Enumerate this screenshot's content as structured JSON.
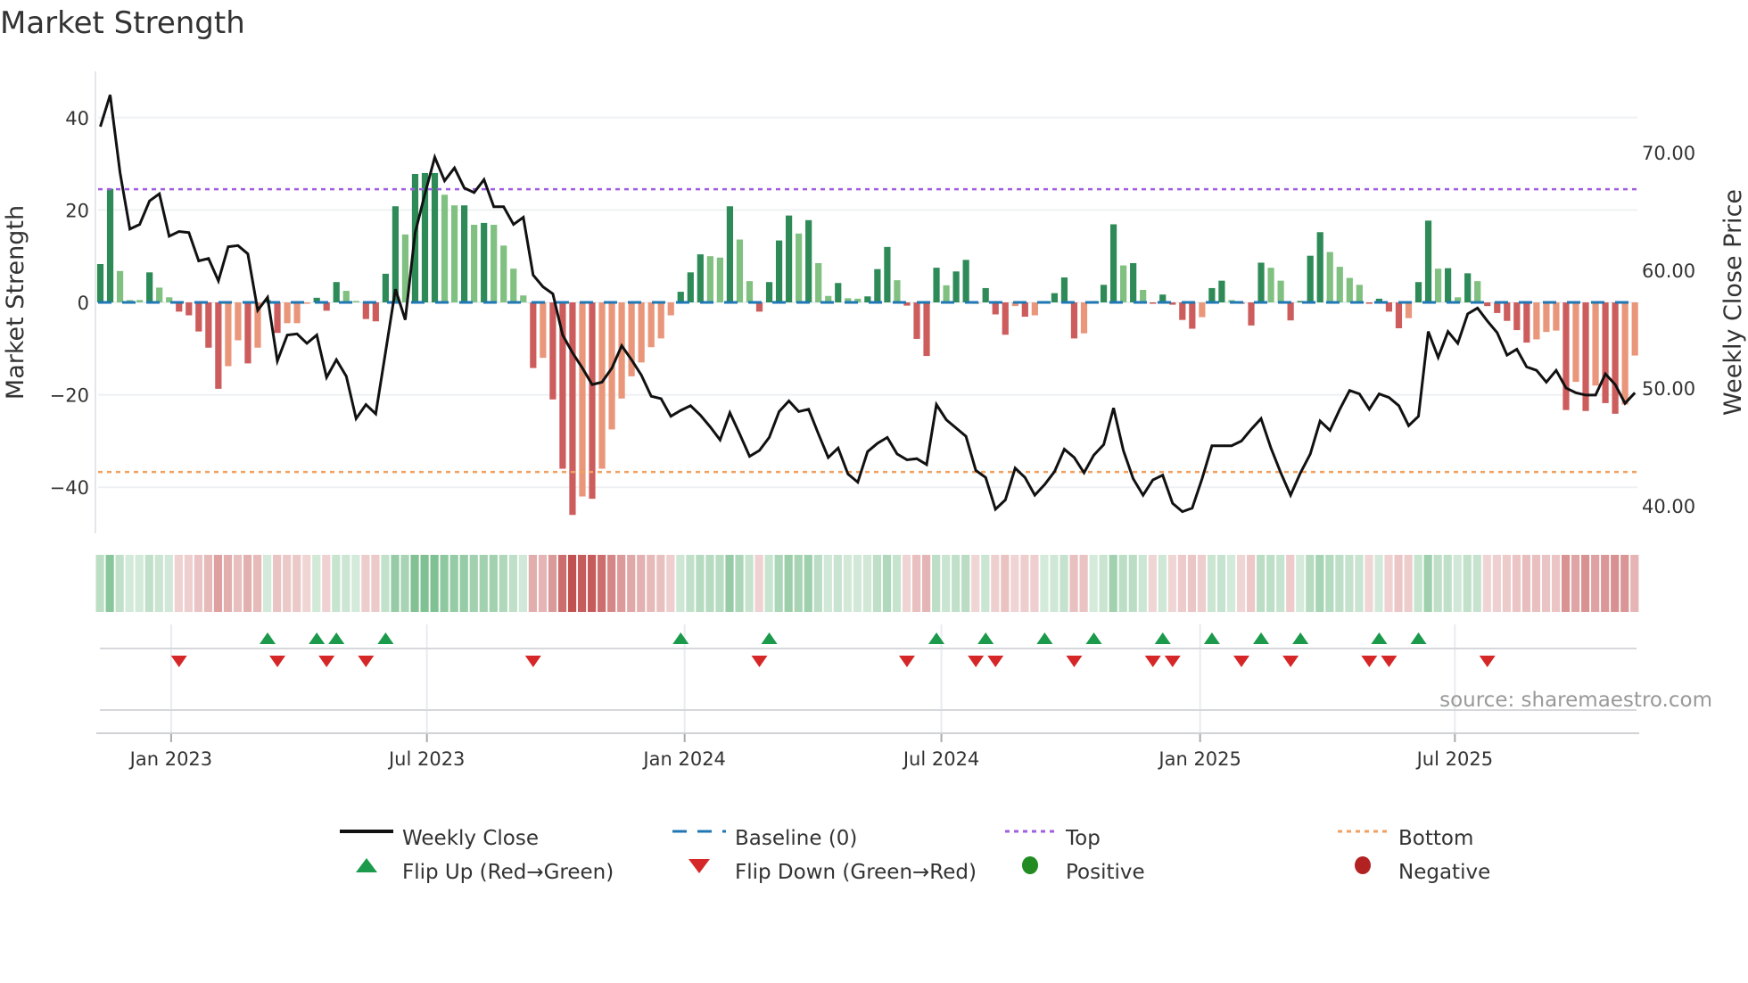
{
  "title": "Market Strength",
  "source": "source: sharemaestro.com",
  "colors": {
    "strong_green": "#2e8b57",
    "weak_green": "#80c080",
    "strong_red": "#cd5c5c",
    "weak_red": "#e9967a",
    "baseline": "#1f77b4",
    "top": "#a05ee0",
    "bottom": "#f0a060",
    "flip_up": "#1a9a4a",
    "flip_down": "#d62728",
    "positive": "#228b22",
    "negative": "#b22222",
    "close": "#111111"
  },
  "legend": [
    {
      "label": "Weekly Close",
      "icon": "solid-line"
    },
    {
      "label": "Baseline (0)",
      "icon": "dashed-line"
    },
    {
      "label": "Top",
      "icon": "dotted-line"
    },
    {
      "label": "Bottom",
      "icon": "dotted-line"
    },
    {
      "label": "Flip Up (Red→Green)",
      "icon": "triangle-up"
    },
    {
      "label": "Flip Down (Green→Red)",
      "icon": "triangle-down"
    },
    {
      "label": "Positive",
      "icon": "circle"
    },
    {
      "label": "Negative",
      "icon": "circle"
    }
  ],
  "chart_data": {
    "type": "bar+line",
    "title": "Market Strength",
    "ylabel": "Market Strength",
    "y2label": "Weekly Close Price",
    "ylim": [
      -50,
      50
    ],
    "y2lim": [
      37.65,
      76.9
    ],
    "yticks": [
      40,
      20,
      0,
      -20,
      -40
    ],
    "y2ticks": [
      "70.00",
      "60.00",
      "50.00",
      "40.00"
    ],
    "y2tick_values": [
      70,
      60,
      50,
      40
    ],
    "xticks": [
      {
        "label": "Jan 2023",
        "week": 7.2
      },
      {
        "label": "Jul 2023",
        "week": 33.2
      },
      {
        "label": "Jan 2024",
        "week": 59.4
      },
      {
        "label": "Jul 2024",
        "week": 85.5
      },
      {
        "label": "Jan 2025",
        "week": 111.8
      },
      {
        "label": "Jul 2025",
        "week": 137.7
      }
    ],
    "top_level": 24.5,
    "bottom_level": -36.7,
    "baseline": 0,
    "strength": [
      8.3,
      24.6,
      6.8,
      0.5,
      0.5,
      6.5,
      3.2,
      1.1,
      -2,
      -2.8,
      -6.3,
      -9.8,
      -18.7,
      -13.8,
      -8.2,
      -13.2,
      -9.8,
      0.5,
      -6.6,
      -4.5,
      -4.5,
      -0.3,
      1,
      -1.8,
      4.4,
      2.5,
      0.3,
      -3.6,
      -4.1,
      6.2,
      20.8,
      14.7,
      27.8,
      28,
      28,
      23.3,
      21,
      21,
      16.8,
      17.2,
      16.8,
      12.3,
      7.3,
      1.5,
      -14.2,
      -12,
      -21,
      -36,
      -46,
      -42,
      -42.5,
      -36,
      -27.5,
      -20.8,
      -16,
      -13,
      -9.7,
      -7.8,
      -2.8,
      2.3,
      6.5,
      10.4,
      10,
      9.7,
      20.8,
      13.6,
      4.6,
      -2,
      4.4,
      13.4,
      18.8,
      14.9,
      17.8,
      8.5,
      1.4,
      4.2,
      0.9,
      0.8,
      1.3,
      7.2,
      12,
      4.8,
      -0.7,
      -7.9,
      -11.6,
      7.5,
      3.7,
      6.7,
      9.2,
      -0.3,
      3.1,
      -2.6,
      -7,
      -0.8,
      -3.1,
      -2.8,
      0.3,
      2,
      5.4,
      -7.8,
      -6.7,
      0.3,
      3.8,
      16.9,
      8,
      8.5,
      2.7,
      -0.3,
      1.7,
      -0.5,
      -3.8,
      -5.7,
      -3.2,
      3.1,
      4.7,
      0.5,
      -0.3,
      -5,
      8.6,
      7.5,
      4.7,
      -3.9,
      0.3,
      10.1,
      15.2,
      10.9,
      7.7,
      5.3,
      3.8,
      -0.3,
      0.8,
      -2,
      -5.6,
      -3.4,
      4.4,
      17.7,
      7.3,
      7.4,
      1.1,
      6.3,
      4.6,
      -0.8,
      -2.3,
      -4,
      -6,
      -8.7,
      -8,
      -6.4,
      -6.1,
      -23.3,
      -17.2,
      -23.5,
      -18,
      -21.8,
      -24.1,
      -22.1,
      -11.5
    ],
    "shade": "GGgggGggRRRRRrrRrGRrrrGRGggRRGGgGGGggGgGggggRrRRRrRrrrrrrrrGGGggGggRGGGgGggGggGGGgRRRGgGGRGRRrRrGGGRrGGGgGgRGRRRrGGgRRGggRGGGggggRGRRrGGgGgGgRRRRRrrrRrRrRRrr",
    "weekly_close": [
      72.2,
      74.9,
      68.3,
      63.5,
      63.9,
      65.9,
      66.5,
      62.9,
      63.3,
      63.2,
      60.8,
      61,
      59.1,
      62,
      62.1,
      61.4,
      56.6,
      57.7,
      52.3,
      54.5,
      54.6,
      53.8,
      54.5,
      50.9,
      52.4,
      51,
      47.4,
      48.6,
      47.8,
      53.1,
      58.4,
      55.8,
      63.2,
      66.5,
      69.6,
      67.6,
      68.7,
      67,
      66.6,
      67.7,
      65.4,
      65.4,
      63.9,
      64.5,
      59.6,
      58.6,
      58,
      54.5,
      53,
      51.7,
      50.3,
      50.5,
      51.7,
      53.6,
      52.4,
      51.1,
      49.3,
      49.1,
      47.6,
      48.1,
      48.5,
      47.7,
      46.7,
      45.6,
      47.9,
      46.1,
      44.2,
      44.7,
      45.8,
      48,
      48.9,
      48,
      48.2,
      46.1,
      44.1,
      44.9,
      42.7,
      42,
      44.6,
      45.3,
      45.8,
      44.4,
      43.9,
      44,
      43.5,
      48.6,
      47.3,
      46.6,
      45.9,
      43,
      42.4,
      39.7,
      40.5,
      43.2,
      42.4,
      40.9,
      41.8,
      42.9,
      44.8,
      44.1,
      42.8,
      44.3,
      45.2,
      48.3,
      44.7,
      42.3,
      40.9,
      42.2,
      42.6,
      40.2,
      39.5,
      39.8,
      42.3,
      45.1,
      45.1,
      45.1,
      45.5,
      46.5,
      47.4,
      44.9,
      42.8,
      40.9,
      42.8,
      44.4,
      47.2,
      46.4,
      48.2,
      49.8,
      49.5,
      48.2,
      49.5,
      49.2,
      48.5,
      46.8,
      47.6,
      54.8,
      52.6,
      54.8,
      53.8,
      56.3,
      56.8,
      55.7,
      54.7,
      52.8,
      53.3,
      51.8,
      51.5,
      50.5,
      51.5,
      50,
      49.6,
      49.4,
      49.4,
      51.2,
      50.3,
      48.7,
      49.6
    ],
    "flip_up_weeks": [
      17,
      22,
      24,
      29,
      59,
      68,
      85,
      90,
      96,
      101,
      108,
      113,
      118,
      122,
      130,
      134
    ],
    "flip_down_weeks": [
      8,
      18,
      23,
      27,
      44,
      67,
      82,
      89,
      91,
      99,
      107,
      109,
      116,
      121,
      129,
      131,
      141
    ]
  }
}
